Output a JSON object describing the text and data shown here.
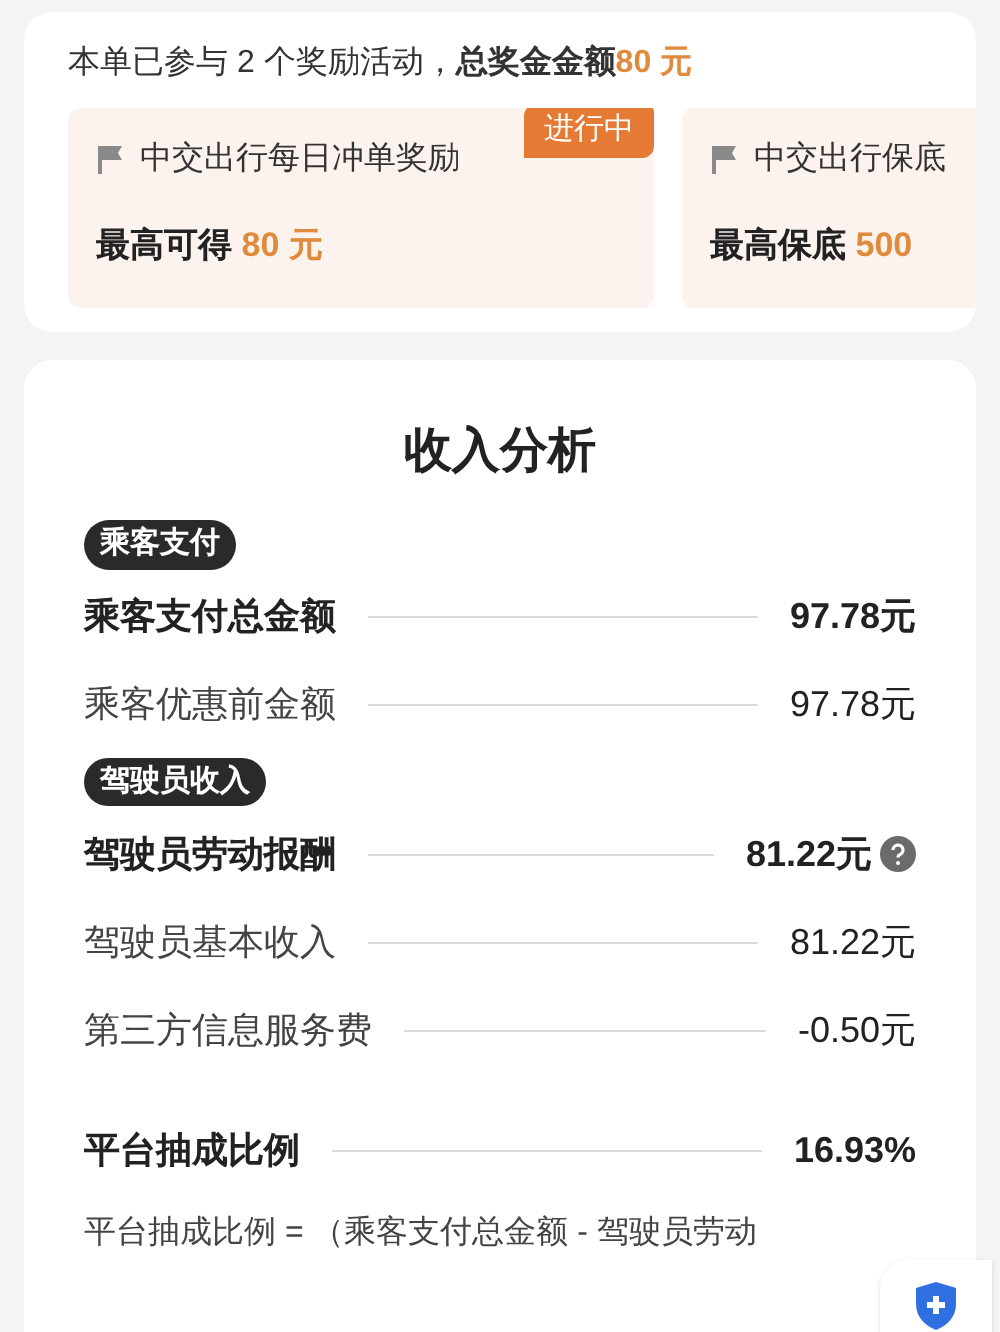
{
  "summary": {
    "text": "本单已参与 2 个奖励活动，**总奖金金额**",
    "amount": "80 元"
  },
  "activities": [
    {
      "name": "中交出行每日冲单奖励",
      "label": "最高可得",
      "amount": "80 元",
      "badge": "进行中"
    },
    {
      "name": "中交出行保底",
      "label": "最高保底",
      "amount": "500"
    }
  ],
  "analysis": {
    "title": "收入分析",
    "sections": [
      {
        "tag": "乘客支付",
        "rows": [
          {
            "kind": "total",
            "label": "乘客支付总金额",
            "value": "97.78元",
            "help": false
          },
          {
            "kind": "item",
            "label": "乘客优惠前金额",
            "value": "97.78元",
            "help": false
          }
        ]
      },
      {
        "tag": "驾驶员收入",
        "rows": [
          {
            "kind": "total",
            "label": "驾驶员劳动报酬",
            "value": "81.22元",
            "help": true
          },
          {
            "kind": "item",
            "label": "驾驶员基本收入",
            "value": "81.22元",
            "help": false
          },
          {
            "kind": "item",
            "label": "第三方信息服务费",
            "value": "-0.50元",
            "help": false
          }
        ]
      },
      {
        "rows": [
          {
            "kind": "total",
            "label": "平台抽成比例",
            "value": "16.93%",
            "help": false
          }
        ]
      }
    ],
    "formula": "平台抽成比例 = （乘客支付总金额 - 驾驶员劳动"
  }
}
